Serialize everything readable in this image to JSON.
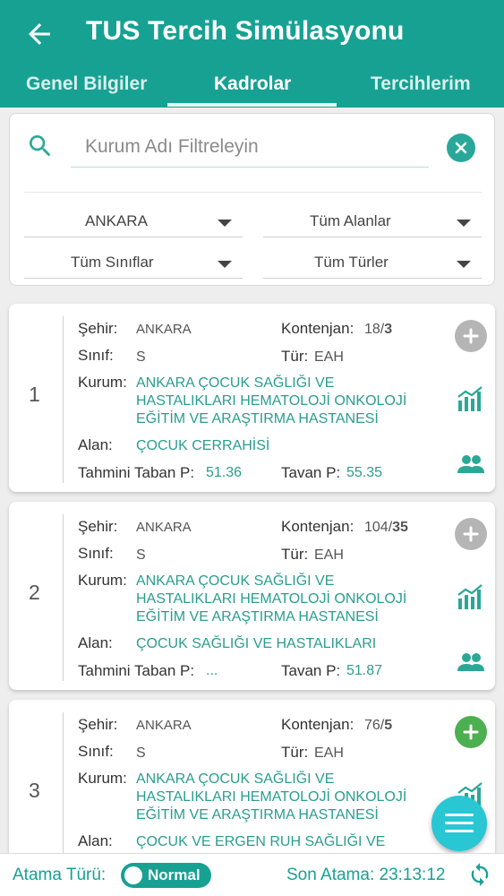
{
  "app": {
    "title": "TUS Tercih Simülasyonu",
    "color_primary": "#17a193",
    "color_link": "#2a9d8f"
  },
  "tabs": [
    {
      "label": "Genel Bilgiler",
      "active": false
    },
    {
      "label": "Kadrolar",
      "active": true
    },
    {
      "label": "Tercihlerim",
      "active": false
    }
  ],
  "filter": {
    "search_placeholder": "Kurum Adı Filtreleyin",
    "city": "ANKARA",
    "field": "Tüm Alanlar",
    "class": "Tüm Sınıflar",
    "type": "Tüm Türler"
  },
  "labels": {
    "sehir": "Şehir:",
    "sinif": "Sınıf:",
    "kurum": "Kurum:",
    "alan": "Alan:",
    "kontenjan": "Kontenjan:",
    "tur": "Tür:",
    "taban": "Tahmini Taban P:",
    "tavan": "Tavan P:"
  },
  "cards": [
    {
      "rank": "1",
      "sehir": "ANKARA",
      "sinif": "S",
      "kontenjan_total": "18/",
      "kontenjan_filled": "3",
      "tur": "EAH",
      "kurum_lines": [
        "ANKARA ÇOCUK SAĞLIĞI VE",
        "HASTALIKLARI HEMATOLOJİ ONKOLOJİ",
        "EĞİTİM VE ARAŞTIRMA HASTANESİ"
      ],
      "alan": "ÇOCUK CERRAHİSİ",
      "taban": "51.36",
      "tavan": "55.35",
      "add_state": "grey"
    },
    {
      "rank": "2",
      "sehir": "ANKARA",
      "sinif": "S",
      "kontenjan_total": "104/",
      "kontenjan_filled": "35",
      "tur": "EAH",
      "kurum_lines": [
        "ANKARA ÇOCUK SAĞLIĞI VE",
        "HASTALIKLARI HEMATOLOJİ ONKOLOJİ",
        "EĞİTİM VE ARAŞTIRMA HASTANESİ"
      ],
      "alan": "ÇOCUK SAĞLIĞI VE HASTALIKLARI",
      "taban": "...",
      "tavan": "51.87",
      "add_state": "grey"
    },
    {
      "rank": "3",
      "sehir": "ANKARA",
      "sinif": "S",
      "kontenjan_total": "76/",
      "kontenjan_filled": "5",
      "tur": "EAH",
      "kurum_lines": [
        "ANKARA ÇOCUK SAĞLIĞI VE",
        "HASTALIKLARI HEMATOLOJİ ONKOLOJİ",
        "EĞİTİM VE ARAŞTIRMA HASTANESİ"
      ],
      "alan": "ÇOCUK VE ERGEN RUH SAĞLIĞI VE",
      "taban": "",
      "tavan": "",
      "add_state": "green"
    }
  ],
  "bottom": {
    "atama_label": "Atama Türü:",
    "toggle_text": "Normal",
    "son_atama_label": "Son Atama: 23:13:12"
  },
  "icons": {
    "back": "arrow-left-icon",
    "search": "search-icon",
    "clear": "close-circle-icon",
    "add": "plus-circle-icon",
    "chart": "bar-chart-icon",
    "people": "people-icon",
    "menu": "menu-icon",
    "refresh": "refresh-icon"
  }
}
